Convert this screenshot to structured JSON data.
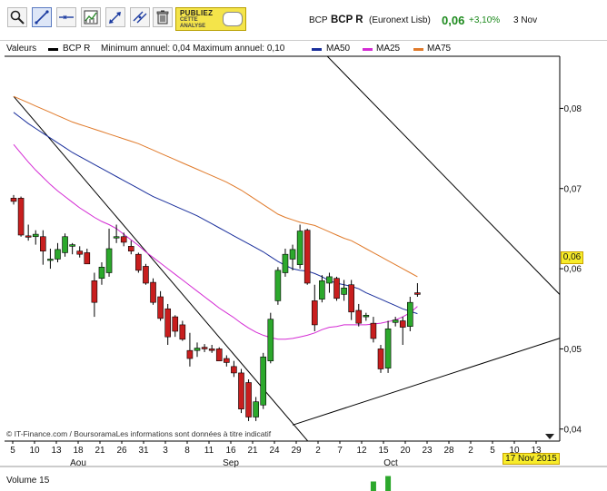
{
  "toolbar": {
    "tools": [
      {
        "icon": "zoom-icon"
      },
      {
        "icon": "draw-line-icon"
      },
      {
        "icon": "horizontal-line-icon"
      },
      {
        "icon": "indicators-icon"
      },
      {
        "icon": "trend-arrows-icon"
      },
      {
        "icon": "parallel-lines-icon"
      },
      {
        "icon": "trash-icon"
      }
    ],
    "promo_line1": "PUBLIEZ",
    "promo_line2": "CETTE",
    "promo_line3": "ANALYSE"
  },
  "header": {
    "code": "BCP",
    "name": "BCP R",
    "exchange": "(Euronext Lisb)",
    "price": "0,06",
    "change": "+3,10%",
    "date": "3 Nov"
  },
  "legend": {
    "valeurs_label": "Valeurs",
    "series_name": "BCP R",
    "range_text": "Minimum annuel: 0,04 Maximum annuel: 0,10",
    "ma50": "MA50",
    "ma25": "MA25",
    "ma75": "MA75",
    "colors": {
      "price": "#000000",
      "ma50": "#1a2f9c",
      "ma25": "#d42bd4",
      "ma75": "#e07a2a",
      "up": "#2ca82c",
      "down": "#c81e1e"
    }
  },
  "price_box": "0,06",
  "date_box": "17 Nov 2015",
  "credit": "© IT-Finance.com / BoursoramaLes informations sont données à titre indicatif",
  "volume_label": "Volume 15",
  "chart_data": {
    "type": "candlestick",
    "y_tick_labels": [
      "0,08",
      "0,07",
      "0,06",
      "0,05",
      "0,04"
    ],
    "y_ticks": [
      0.08,
      0.07,
      0.06,
      0.05,
      0.04
    ],
    "ylim": [
      0.0385,
      0.0865
    ],
    "x_tick_labels": [
      "5",
      "10",
      "13",
      "18",
      "21",
      "26",
      "31",
      "3",
      "8",
      "11",
      "16",
      "21",
      "24",
      "29",
      "2",
      "7",
      "12",
      "15",
      "20",
      "23",
      "28",
      "2",
      "5",
      "10",
      "13"
    ],
    "month_labels": [
      "Aou",
      "Sep",
      "Oct"
    ],
    "candles": [
      {
        "o": 0.0688,
        "h": 0.0692,
        "l": 0.068,
        "c": 0.0684
      },
      {
        "o": 0.0688,
        "h": 0.069,
        "l": 0.064,
        "c": 0.0642
      },
      {
        "o": 0.0641,
        "h": 0.0655,
        "l": 0.0635,
        "c": 0.064
      },
      {
        "o": 0.064,
        "h": 0.0648,
        "l": 0.063,
        "c": 0.0643
      },
      {
        "o": 0.064,
        "h": 0.0648,
        "l": 0.0605,
        "c": 0.0622
      },
      {
        "o": 0.0612,
        "h": 0.0625,
        "l": 0.06,
        "c": 0.0612
      },
      {
        "o": 0.0612,
        "h": 0.0632,
        "l": 0.0608,
        "c": 0.0624
      },
      {
        "o": 0.062,
        "h": 0.0644,
        "l": 0.0615,
        "c": 0.064
      },
      {
        "o": 0.0628,
        "h": 0.0632,
        "l": 0.0618,
        "c": 0.063
      },
      {
        "o": 0.0622,
        "h": 0.0628,
        "l": 0.0614,
        "c": 0.0618
      },
      {
        "o": 0.062,
        "h": 0.0625,
        "l": 0.0608,
        "c": 0.0606
      },
      {
        "o": 0.0585,
        "h": 0.0595,
        "l": 0.054,
        "c": 0.0558
      },
      {
        "o": 0.0588,
        "h": 0.0608,
        "l": 0.058,
        "c": 0.0602
      },
      {
        "o": 0.0595,
        "h": 0.065,
        "l": 0.059,
        "c": 0.0625
      },
      {
        "o": 0.064,
        "h": 0.0655,
        "l": 0.0632,
        "c": 0.064
      },
      {
        "o": 0.064,
        "h": 0.0645,
        "l": 0.0628,
        "c": 0.0633
      },
      {
        "o": 0.0628,
        "h": 0.0635,
        "l": 0.0618,
        "c": 0.0622
      },
      {
        "o": 0.0618,
        "h": 0.062,
        "l": 0.0595,
        "c": 0.0598
      },
      {
        "o": 0.0603,
        "h": 0.0606,
        "l": 0.058,
        "c": 0.0582
      },
      {
        "o": 0.0583,
        "h": 0.0588,
        "l": 0.0555,
        "c": 0.0558
      },
      {
        "o": 0.0565,
        "h": 0.0572,
        "l": 0.0535,
        "c": 0.0538
      },
      {
        "o": 0.055,
        "h": 0.0556,
        "l": 0.0505,
        "c": 0.0515
      },
      {
        "o": 0.054,
        "h": 0.0542,
        "l": 0.0515,
        "c": 0.0522
      },
      {
        "o": 0.053,
        "h": 0.0535,
        "l": 0.051,
        "c": 0.0512
      },
      {
        "o": 0.0498,
        "h": 0.052,
        "l": 0.0478,
        "c": 0.0488
      },
      {
        "o": 0.0498,
        "h": 0.0508,
        "l": 0.049,
        "c": 0.0501
      },
      {
        "o": 0.0502,
        "h": 0.0506,
        "l": 0.0496,
        "c": 0.05
      },
      {
        "o": 0.05,
        "h": 0.0505,
        "l": 0.0495,
        "c": 0.0498
      },
      {
        "o": 0.05,
        "h": 0.0502,
        "l": 0.0485,
        "c": 0.0485
      },
      {
        "o": 0.0488,
        "h": 0.0492,
        "l": 0.0478,
        "c": 0.0483
      },
      {
        "o": 0.0478,
        "h": 0.0485,
        "l": 0.0465,
        "c": 0.047
      },
      {
        "o": 0.047,
        "h": 0.0475,
        "l": 0.042,
        "c": 0.0425
      },
      {
        "o": 0.0458,
        "h": 0.0462,
        "l": 0.041,
        "c": 0.0415
      },
      {
        "o": 0.0415,
        "h": 0.044,
        "l": 0.041,
        "c": 0.0434
      },
      {
        "o": 0.043,
        "h": 0.0495,
        "l": 0.0425,
        "c": 0.049
      },
      {
        "o": 0.0485,
        "h": 0.0545,
        "l": 0.0482,
        "c": 0.0537
      },
      {
        "o": 0.056,
        "h": 0.0602,
        "l": 0.0555,
        "c": 0.0598
      },
      {
        "o": 0.0595,
        "h": 0.0625,
        "l": 0.059,
        "c": 0.0618
      },
      {
        "o": 0.0612,
        "h": 0.063,
        "l": 0.0598,
        "c": 0.0624
      },
      {
        "o": 0.0605,
        "h": 0.0655,
        "l": 0.06,
        "c": 0.0647
      },
      {
        "o": 0.0648,
        "h": 0.065,
        "l": 0.058,
        "c": 0.0582
      },
      {
        "o": 0.056,
        "h": 0.058,
        "l": 0.0522,
        "c": 0.053
      },
      {
        "o": 0.0562,
        "h": 0.0592,
        "l": 0.0558,
        "c": 0.0585
      },
      {
        "o": 0.0582,
        "h": 0.0595,
        "l": 0.057,
        "c": 0.059
      },
      {
        "o": 0.0588,
        "h": 0.059,
        "l": 0.056,
        "c": 0.0563
      },
      {
        "o": 0.0568,
        "h": 0.0586,
        "l": 0.056,
        "c": 0.0576
      },
      {
        "o": 0.058,
        "h": 0.0586,
        "l": 0.0536,
        "c": 0.0546
      },
      {
        "o": 0.0548,
        "h": 0.0556,
        "l": 0.0528,
        "c": 0.0532
      },
      {
        "o": 0.054,
        "h": 0.0545,
        "l": 0.0535,
        "c": 0.0542
      },
      {
        "o": 0.0532,
        "h": 0.054,
        "l": 0.0508,
        "c": 0.0513
      },
      {
        "o": 0.05,
        "h": 0.0505,
        "l": 0.047,
        "c": 0.0475
      },
      {
        "o": 0.0476,
        "h": 0.0535,
        "l": 0.047,
        "c": 0.0525
      },
      {
        "o": 0.0533,
        "h": 0.054,
        "l": 0.0528,
        "c": 0.0536
      },
      {
        "o": 0.0535,
        "h": 0.054,
        "l": 0.0505,
        "c": 0.0527
      },
      {
        "o": 0.0528,
        "h": 0.0565,
        "l": 0.0522,
        "c": 0.0558
      },
      {
        "o": 0.057,
        "h": 0.0582,
        "l": 0.0565,
        "c": 0.0568
      }
    ],
    "ma25": [
      0.0755,
      0.0744,
      0.0733,
      0.0723,
      0.0714,
      0.0705,
      0.0697,
      0.069,
      0.0683,
      0.0676,
      0.067,
      0.0664,
      0.0659,
      0.0655,
      0.065,
      0.0643,
      0.0636,
      0.0629,
      0.0621,
      0.0614,
      0.0607,
      0.06,
      0.0593,
      0.0586,
      0.0579,
      0.0572,
      0.0565,
      0.0558,
      0.0551,
      0.0545,
      0.0539,
      0.0532,
      0.0526,
      0.0521,
      0.0517,
      0.0514,
      0.0512,
      0.0512,
      0.0513,
      0.0515,
      0.0517,
      0.052,
      0.0524,
      0.0527,
      0.0528,
      0.053,
      0.053,
      0.053,
      0.053,
      0.0531,
      0.0532,
      0.0534,
      0.0536,
      0.054,
      0.0545,
      0.0553
    ],
    "ma50": [
      0.0795,
      0.0788,
      0.0781,
      0.0775,
      0.0769,
      0.0763,
      0.0757,
      0.0751,
      0.0745,
      0.074,
      0.0735,
      0.073,
      0.0725,
      0.072,
      0.0715,
      0.071,
      0.0705,
      0.07,
      0.0695,
      0.069,
      0.0686,
      0.0682,
      0.0678,
      0.0674,
      0.067,
      0.0666,
      0.0661,
      0.0656,
      0.0651,
      0.0646,
      0.0641,
      0.0636,
      0.0631,
      0.0626,
      0.0621,
      0.0615,
      0.0609,
      0.0604,
      0.06,
      0.0598,
      0.0597,
      0.0594,
      0.059,
      0.0585,
      0.0582,
      0.058,
      0.0578,
      0.0575,
      0.057,
      0.0566,
      0.0562,
      0.0558,
      0.0554,
      0.055,
      0.0547,
      0.0544
    ],
    "ma75": [
      0.0815,
      0.0811,
      0.0807,
      0.0803,
      0.0799,
      0.0795,
      0.0791,
      0.0787,
      0.0783,
      0.078,
      0.0777,
      0.0774,
      0.0771,
      0.0768,
      0.0765,
      0.0762,
      0.0759,
      0.0756,
      0.0752,
      0.0748,
      0.0744,
      0.074,
      0.0736,
      0.0732,
      0.0728,
      0.0724,
      0.072,
      0.0716,
      0.0712,
      0.0708,
      0.0703,
      0.0698,
      0.0692,
      0.0686,
      0.068,
      0.0674,
      0.0668,
      0.0664,
      0.0661,
      0.0658,
      0.0656,
      0.0654,
      0.065,
      0.0646,
      0.0642,
      0.0638,
      0.0635,
      0.063,
      0.0625,
      0.062,
      0.0615,
      0.061,
      0.0605,
      0.06,
      0.0595,
      0.059
    ],
    "trendlines": [
      {
        "from": [
          0,
          0.0815
        ],
        "to": [
          41,
          0.0375
        ]
      },
      {
        "from": [
          31,
          0.0975
        ],
        "to": [
          88,
          0.044
        ]
      },
      {
        "from": [
          38,
          0.0405
        ],
        "to": [
          81,
          0.0533
        ]
      }
    ],
    "volume_bars": [
      {
        "index": 49,
        "value": 0.35
      },
      {
        "index": 51,
        "value": 0.55
      }
    ],
    "grid": false
  }
}
